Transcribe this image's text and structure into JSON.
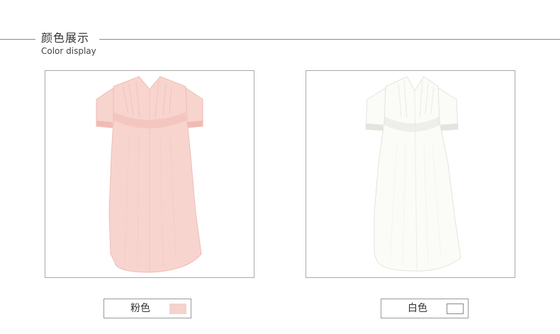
{
  "header": {
    "title_cn": "颜色展示",
    "title_en": "Color display"
  },
  "products": [
    {
      "color_name": "粉色",
      "dress_color": "#f8d4cf",
      "dress_shade": "#efbcb5",
      "chip_color": "#f4d2cd",
      "chip_border": "#f4d2cd"
    },
    {
      "color_name": "白色",
      "dress_color": "#fbfbf8",
      "dress_shade": "#e4e3de",
      "chip_color": "#ffffff",
      "chip_border": "#8a8a8a"
    }
  ]
}
